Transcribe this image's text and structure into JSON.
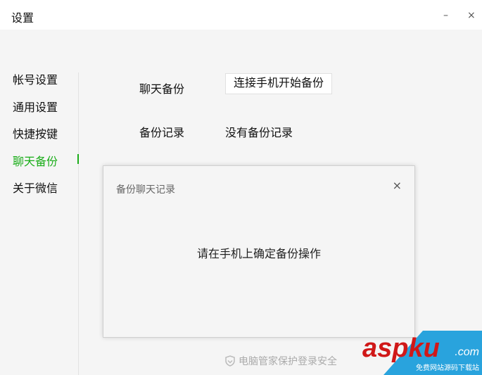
{
  "window": {
    "title": "设置",
    "minimize": "–",
    "close": "×"
  },
  "sidebar": {
    "items": [
      {
        "label": "帐号设置"
      },
      {
        "label": "通用设置"
      },
      {
        "label": "快捷按键"
      },
      {
        "label": "聊天备份",
        "active": true
      },
      {
        "label": "关于微信"
      }
    ]
  },
  "main": {
    "backup_label": "聊天备份",
    "backup_button": "连接手机开始备份",
    "record_label": "备份记录",
    "record_value": "没有备份记录"
  },
  "dialog": {
    "title": "备份聊天记录",
    "close": "×",
    "message": "请在手机上确定备份操作"
  },
  "footer": {
    "text": "电脑管家保护登录安全"
  },
  "watermark": {
    "brand": "aspku",
    ".com": ".com",
    "tagline": "免费网站源码下载站"
  },
  "colors": {
    "accent": "#1aad19"
  }
}
